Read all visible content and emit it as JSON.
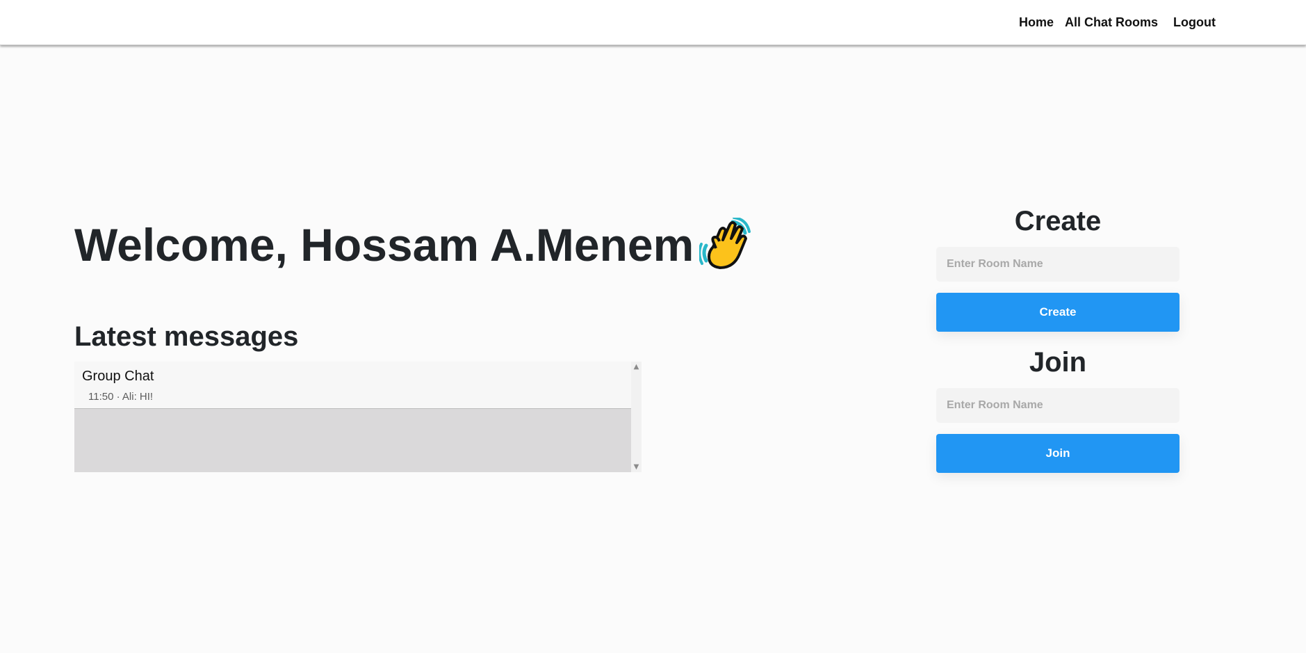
{
  "nav": {
    "home": "Home",
    "all_rooms": "All Chat Rooms",
    "logout": "Logout"
  },
  "welcome": {
    "text": "Welcome, Hossam A.Menem",
    "icon": "waving-hand-icon"
  },
  "latest": {
    "title": "Latest messages",
    "messages": [
      {
        "room": "Group Chat",
        "preview": "11:50 · Ali: HI!"
      }
    ]
  },
  "create": {
    "title": "Create",
    "placeholder": "Enter Room Name",
    "button": "Create"
  },
  "join": {
    "title": "Join",
    "placeholder": "Enter Room Name",
    "button": "Join"
  },
  "colors": {
    "accent": "#2196f3",
    "background": "#fbfbfb"
  }
}
